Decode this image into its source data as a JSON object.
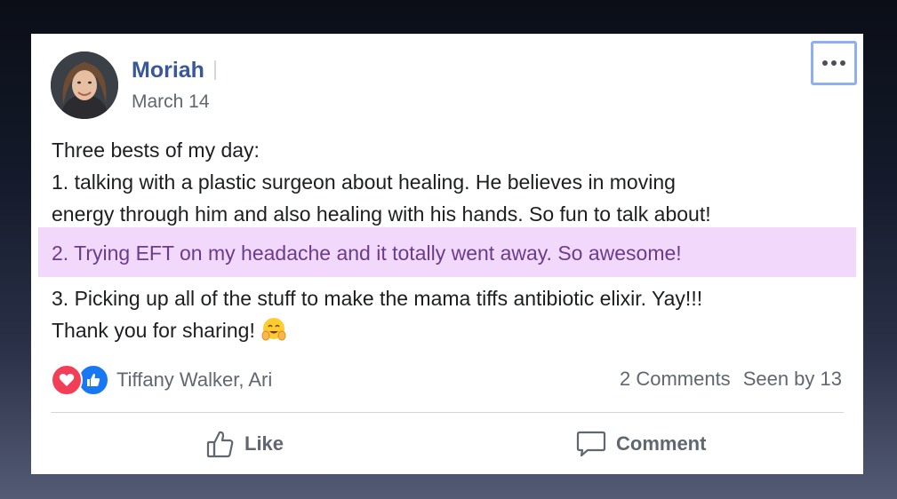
{
  "post": {
    "author": "Moriah",
    "date": "March 14",
    "body_lines": [
      "Three bests of my day:",
      "1. talking with a plastic surgeon about healing. He believes in moving",
      "energy through him and also healing with his hands. So fun to talk about!"
    ],
    "highlighted_line": "2. Trying EFT on my headache and it totally went away. So awesome!",
    "body_lines_after": [
      "3. Picking up all of the stuff to make the mama tiffs antibiotic elixir. Yay!!!",
      "Thank you for sharing!"
    ],
    "emoji": "hugging-face-emoji"
  },
  "reactions": {
    "icons": [
      "love-icon",
      "like-icon"
    ],
    "names": "Tiffany Walker, Ari"
  },
  "stats": {
    "comments": "2 Comments",
    "seen": "Seen by 13"
  },
  "actions": {
    "like_label": "Like",
    "comment_label": "Comment"
  },
  "colors": {
    "author": "#385898",
    "highlight_bg": "#f2d9fb",
    "highlight_text": "#6b3c8c",
    "focus_ring": "#8fb0f0"
  }
}
